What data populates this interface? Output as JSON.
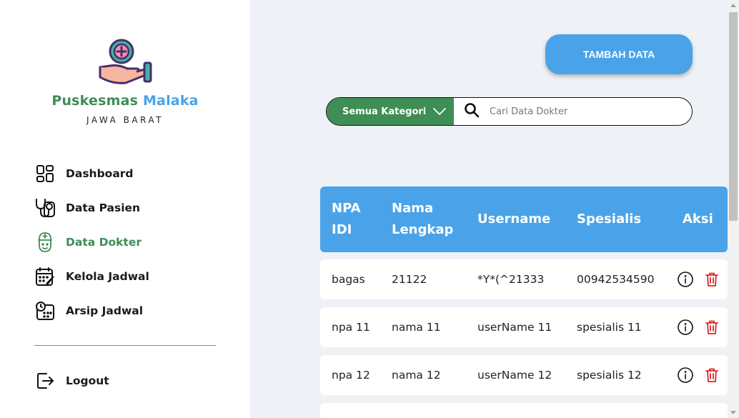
{
  "brand": {
    "name_part1": "Puskesmas",
    "name_part2": "Malaka",
    "subtitle": "JAWA BARAT"
  },
  "nav": {
    "dashboard": "Dashboard",
    "data_pasien": "Data Pasien",
    "data_dokter": "Data Dokter",
    "kelola_jadwal": "Kelola Jadwal",
    "arsip_jadwal": "Arsip Jadwal",
    "logout": "Logout",
    "active": "Data Dokter"
  },
  "toolbar": {
    "add_label": "TAMBAH DATA"
  },
  "search": {
    "category": "Semua Kategori",
    "placeholder": "Cari Data Dokter"
  },
  "table": {
    "headers": {
      "npa_line1": "NPA",
      "npa_line2": "IDI",
      "nama_line1": "Nama",
      "nama_line2": "Lengkap",
      "username": "Username",
      "spesialis": "Spesialis",
      "aksi": "Aksi"
    },
    "rows": [
      {
        "npa": "bagas",
        "nama": "21122",
        "username": "*Y*(^21333",
        "spesialis": "00942534590"
      },
      {
        "npa": "npa 11",
        "nama": "nama 11",
        "username": "userName 11",
        "spesialis": "spesialis 11"
      },
      {
        "npa": "npa 12",
        "nama": "nama 12",
        "username": "userName 12",
        "spesialis": "spesialis 12"
      }
    ]
  },
  "colors": {
    "green": "#3e8e55",
    "blue": "#4aa3e8",
    "red": "#e02424",
    "background": "#eef1f6"
  },
  "icons": {
    "dashboard": "grid-icon",
    "data_pasien": "stethoscope-icon",
    "data_dokter": "doctor-icon",
    "kelola_jadwal": "calendar-edit-icon",
    "arsip_jadwal": "calendar-clock-icon",
    "logout": "logout-icon",
    "search": "search-icon",
    "category": "chevron-down-icon",
    "info": "info-icon",
    "delete": "trash-icon"
  }
}
